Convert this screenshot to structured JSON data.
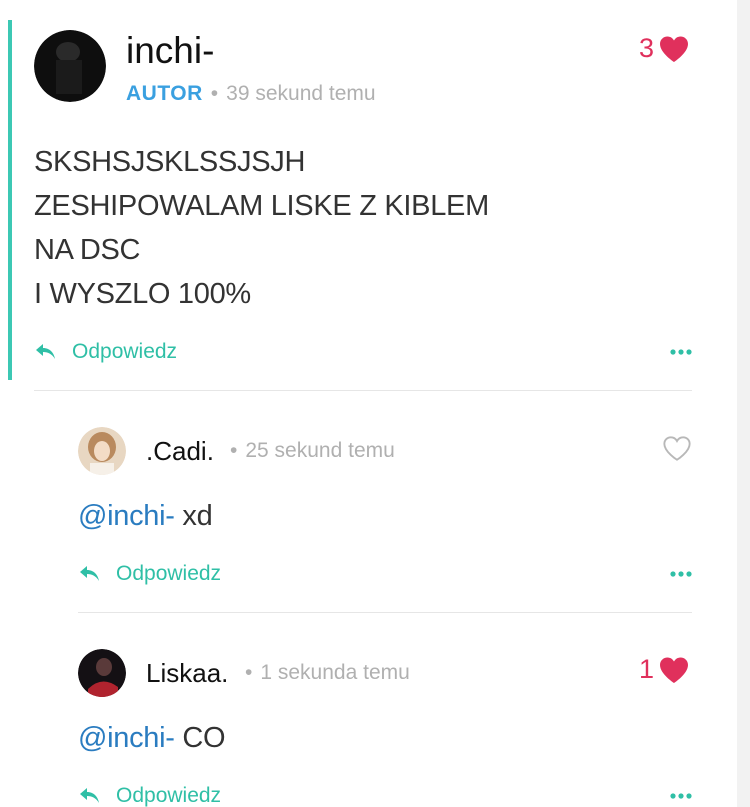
{
  "post": {
    "author": "inchi-",
    "badge": "AUTOR",
    "separator": "•",
    "time": "39 sekund temu",
    "likes": "3",
    "lines": [
      "SKSHSJSKLSSJSJH",
      "ZESHIPOWALAM LISKE Z KIBLEM",
      "NA DSC",
      "I WYSZLO 100%"
    ],
    "reply_label": "Odpowiedz"
  },
  "comments": [
    {
      "author": ".Cadi.",
      "separator": "•",
      "time": "25 sekund temu",
      "likes": "",
      "mention": "@inchi-",
      "text": " xd",
      "reply_label": "Odpowiedz"
    },
    {
      "author": "Liskaa.",
      "separator": "•",
      "time": "1 sekunda temu",
      "likes": "1",
      "mention": "@inchi-",
      "text": " CO",
      "reply_label": "Odpowiedz"
    }
  ],
  "colors": {
    "accent": "#3cc8b4",
    "reply": "#2fbfa6",
    "author_badge": "#3aa0e0",
    "mention": "#2a7cc0",
    "like": "#e0305c"
  },
  "icons": [
    "reply-arrow-icon",
    "more-dots-icon",
    "heart-icon",
    "heart-outline-icon"
  ]
}
